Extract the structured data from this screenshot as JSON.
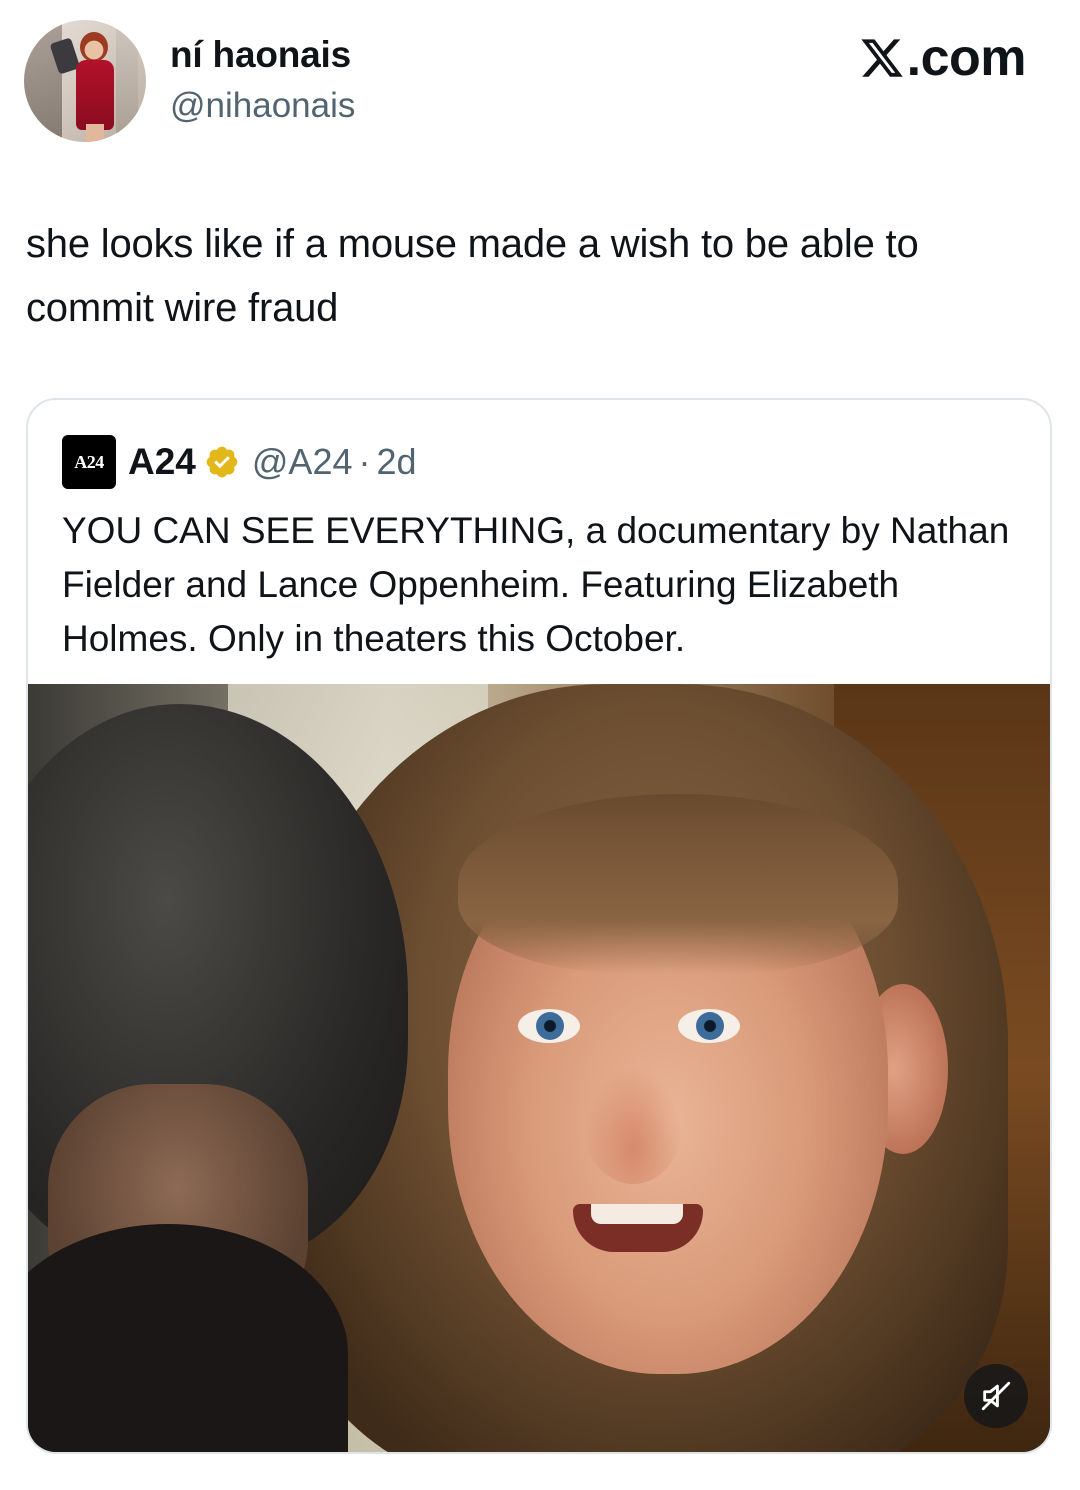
{
  "author": {
    "display_name": "ní haonais",
    "handle": "@nihaonais",
    "avatar_icon": "profile-photo"
  },
  "site": {
    "label": ".com",
    "logo_icon": "x-logo-icon"
  },
  "tweet": {
    "text": "she looks like if a mouse made a wish to be able to commit wire fraud"
  },
  "quoted_tweet": {
    "avatar_text": "A24",
    "display_name": "A24",
    "verified_color": "#e2b719",
    "handle": "@A24",
    "separator": "·",
    "time": "2d",
    "text": "YOU CAN SEE EVERYTHING, a documentary by Nathan Fielder and Lance Oppenheim. Featuring Elizabeth Holmes. Only in theaters this October.",
    "media": {
      "type": "video",
      "mute_icon": "muted-speaker-icon"
    }
  },
  "colors": {
    "text_primary": "#0f1419",
    "text_secondary": "#536471",
    "card_border": "#dfe4e8"
  }
}
